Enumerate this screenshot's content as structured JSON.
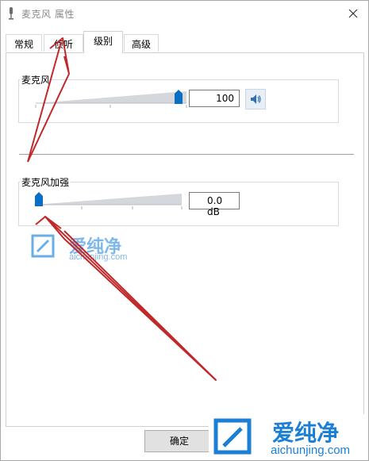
{
  "window": {
    "title": "麦克风 属性"
  },
  "tabs": [
    {
      "label": "常规",
      "active": false
    },
    {
      "label": "侦听",
      "active": false
    },
    {
      "label": "级别",
      "active": true
    },
    {
      "label": "高级",
      "active": false
    }
  ],
  "microphone": {
    "label": "麦克风",
    "value": "100",
    "level_fraction": 1.0,
    "speaker_icon": "speaker-icon"
  },
  "boost": {
    "label": "麦克风加强",
    "value": "0.0 dB",
    "level_fraction": 0.0
  },
  "buttons": {
    "ok_label": "确定"
  },
  "watermark": {
    "cn": "爱纯净",
    "en": "aichunjing.com"
  },
  "colors": {
    "thumb": "#0a6fc2",
    "arrow": "#c0282a",
    "watermark": "#1c7fd6"
  }
}
